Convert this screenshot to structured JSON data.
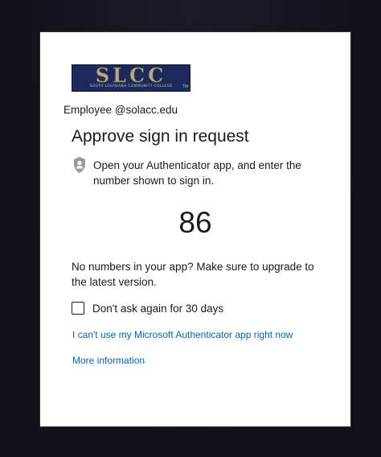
{
  "logo": {
    "text": "SLCC",
    "subtitle": "SOUTH LOUISIANA COMMUNITY COLLEGE",
    "trademark": "TM"
  },
  "account": {
    "label": "Employee @solacc.edu"
  },
  "title": "Approve sign in request",
  "instruction": "Open your Authenticator app, and enter the number shown to sign in.",
  "number": "86",
  "upgrade_text": "No numbers in your app? Make sure to upgrade to the latest version.",
  "checkbox": {
    "label": "Don't ask again for 30 days",
    "checked": false
  },
  "links": {
    "cant_use": "I can't use my Microsoft Authenticator app right now",
    "more_info": "More information"
  },
  "colors": {
    "background": "#15141e",
    "card": "#ffffff",
    "link": "#0067b8",
    "logo_bg": "#1b2a5a",
    "logo_text": "#b8a98a"
  },
  "icons": {
    "instruction_icon": "lock-person-icon"
  }
}
